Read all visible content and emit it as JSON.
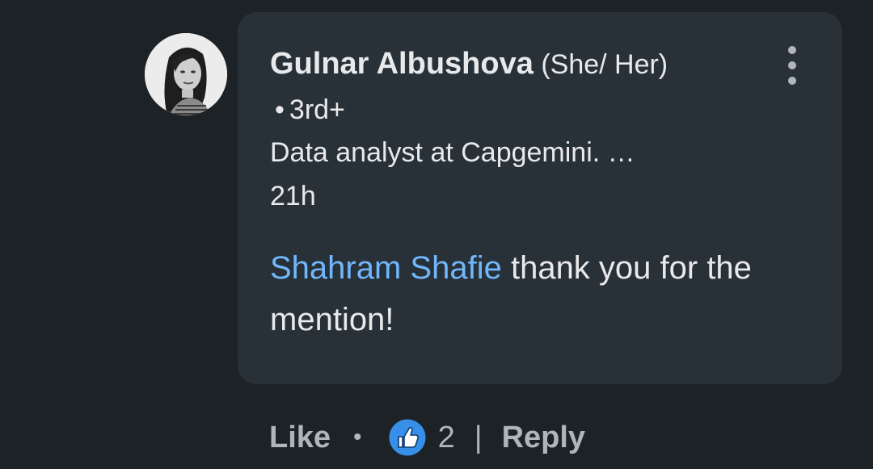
{
  "comment": {
    "author_name": "Gulnar Albushova",
    "pronouns": "(She/ Her)",
    "separator": "•",
    "connection_degree": "3rd+",
    "headline": "Data analyst at Capgemini. …",
    "timestamp": "21h",
    "mention": "Shahram Shafie",
    "text": " thank you for the mention!"
  },
  "actions": {
    "like_label": "Like",
    "separator": "•",
    "reaction_icon": "like-thumbs-up-icon",
    "reaction_count": "2",
    "divider": "|",
    "reply_label": "Reply"
  },
  "colors": {
    "background": "#1d2226",
    "bubble": "#293138",
    "text": "#e8e9ea",
    "muted": "#b0b5b9",
    "mention": "#71b7fb",
    "reaction_blue": "#378fe9"
  }
}
